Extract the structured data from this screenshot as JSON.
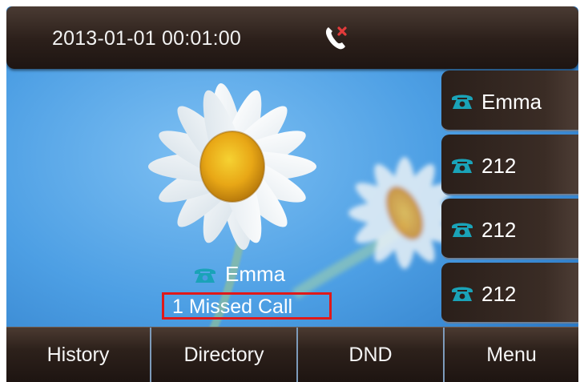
{
  "status_bar": {
    "datetime": "2013-01-01 00:01:00",
    "status_icon": "missed-call-icon"
  },
  "line_keys": [
    {
      "label": "Emma",
      "icon": "phone-icon"
    },
    {
      "label": "212",
      "icon": "phone-icon"
    },
    {
      "label": "212",
      "icon": "phone-icon"
    },
    {
      "label": "212",
      "icon": "phone-icon"
    }
  ],
  "notification": {
    "name": "Emma",
    "icon": "phone-icon",
    "missed_call_text": "1  Missed Call",
    "highlight_color": "#e01919"
  },
  "softkeys": [
    {
      "label": "History"
    },
    {
      "label": "Directory"
    },
    {
      "label": "DND"
    },
    {
      "label": "Menu"
    }
  ],
  "colors": {
    "phone_icon": "#1aa3b8",
    "bar_dark": "#2b1f1a",
    "divider": "#7d9bbb",
    "wallpaper_sky": "#4a9be2"
  }
}
